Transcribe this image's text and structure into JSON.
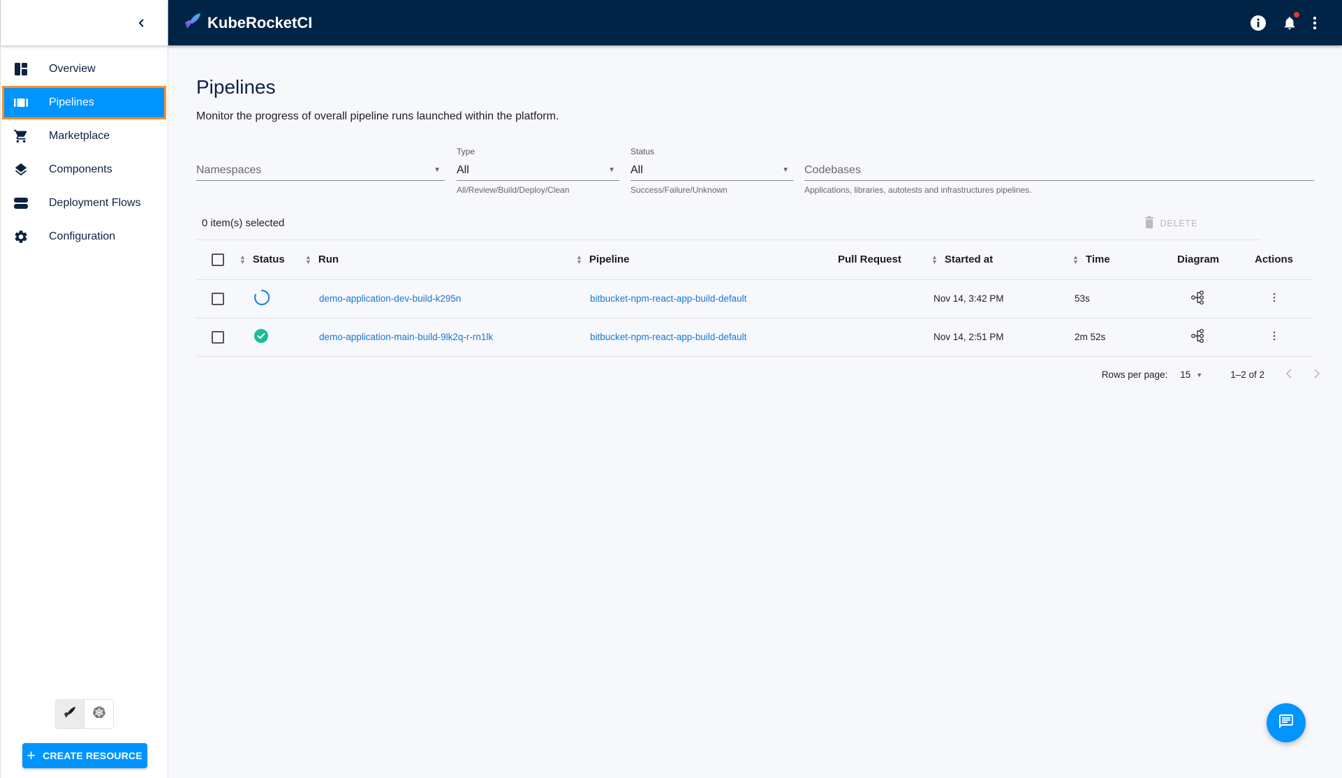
{
  "app": {
    "title": "KubeRocketCI"
  },
  "colors": {
    "topbar": "#002446",
    "accent": "#0094ff",
    "active_outline": "#ff8c27",
    "link": "#1976d2",
    "success": "#18be94",
    "notification": "#e53935"
  },
  "sidebar": {
    "collapse_icon": "chevron-left-icon",
    "items": [
      {
        "label": "Overview",
        "icon": "dashboard-icon",
        "active": false
      },
      {
        "label": "Pipelines",
        "icon": "pipelines-icon",
        "active": true
      },
      {
        "label": "Marketplace",
        "icon": "cart-icon",
        "active": false
      },
      {
        "label": "Components",
        "icon": "layers-icon",
        "active": false
      },
      {
        "label": "Deployment Flows",
        "icon": "deployment-flows-icon",
        "active": false
      },
      {
        "label": "Configuration",
        "icon": "gear-icon",
        "active": false
      }
    ],
    "mode_toggle": [
      "rocket-icon",
      "kubernetes-icon"
    ],
    "create_button": "CREATE RESOURCE"
  },
  "topbar": {
    "icons": [
      "info-icon",
      "bell-icon",
      "more-vertical-icon"
    ]
  },
  "page": {
    "title": "Pipelines",
    "description": "Monitor the progress of overall pipeline runs launched within the platform."
  },
  "filters": {
    "namespaces": {
      "placeholder": "Namespaces"
    },
    "type": {
      "label": "Type",
      "value": "All",
      "helper": "All/Review/Build/Deploy/Clean"
    },
    "status": {
      "label": "Status",
      "value": "All",
      "helper": "Success/Failure/Unknown"
    },
    "codebases": {
      "placeholder": "Codebases",
      "helper": "Applications, libraries, autotests and infrastructures pipelines."
    }
  },
  "selection": {
    "count_text": "0 item(s) selected",
    "delete_label": "DELETE"
  },
  "table": {
    "headers": {
      "status": "Status",
      "run": "Run",
      "pipeline": "Pipeline",
      "pull_request": "Pull Request",
      "started_at": "Started at",
      "time": "Time",
      "diagram": "Diagram",
      "actions": "Actions"
    },
    "rows": [
      {
        "status": "running",
        "run": "demo-application-dev-build-k295n",
        "pipeline": "bitbucket-npm-react-app-build-default",
        "pull_request": "",
        "started_at": "Nov 14, 3:42 PM",
        "time": "53s"
      },
      {
        "status": "success",
        "run": "demo-application-main-build-9lk2q-r-rn1lk",
        "pipeline": "bitbucket-npm-react-app-build-default",
        "pull_request": "",
        "started_at": "Nov 14, 2:51 PM",
        "time": "2m 52s"
      }
    ]
  },
  "pagination": {
    "rows_per_page_label": "Rows per page:",
    "rows_per_page": "15",
    "range": "1–2 of 2"
  }
}
